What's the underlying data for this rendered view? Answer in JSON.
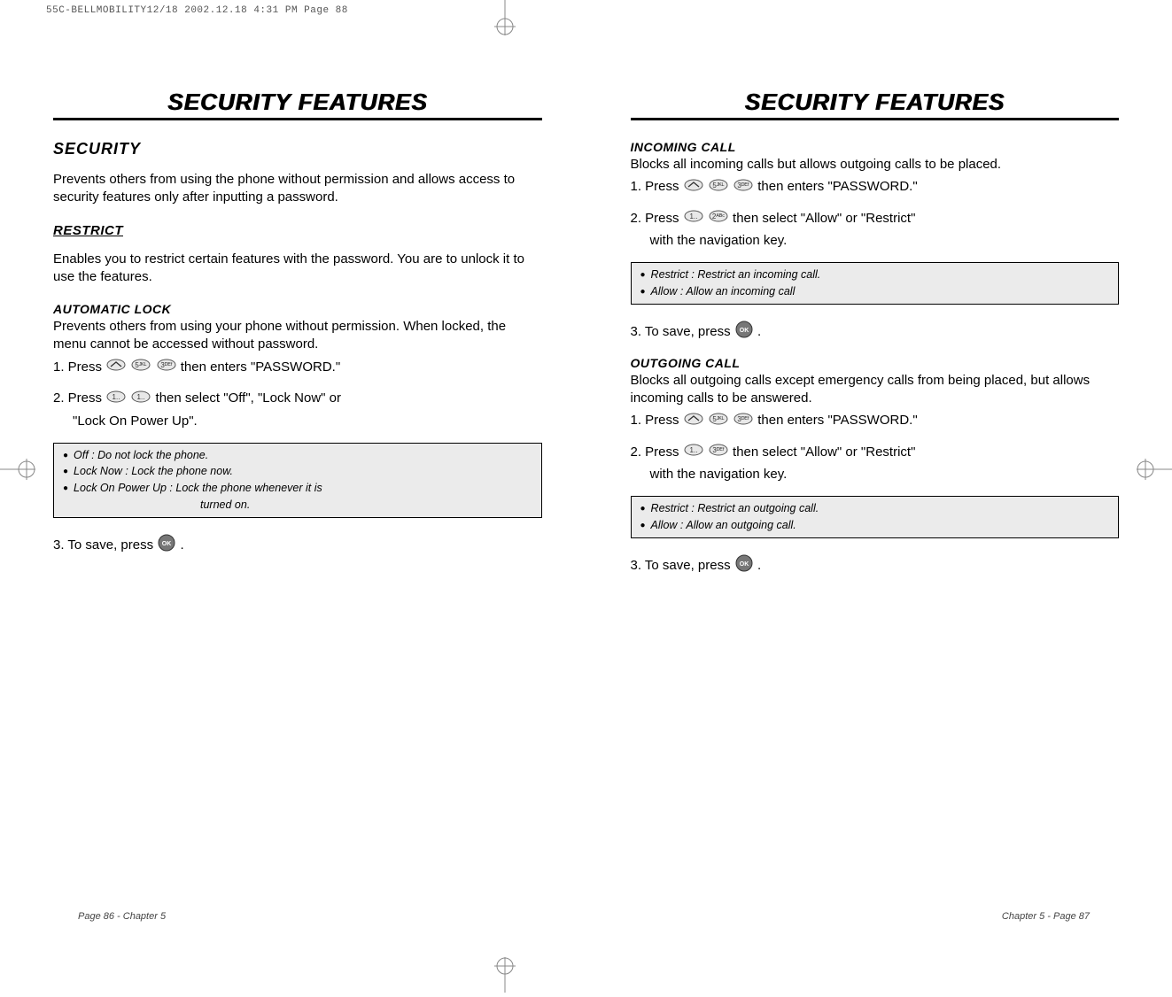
{
  "header": {
    "filename_info": "55C-BELLMOBILITY12/18  2002.12.18  4:31 PM  Page 88"
  },
  "left_page": {
    "title": "SECURITY FEATURES",
    "section": "SECURITY",
    "intro": "Prevents others from using the phone without permission and allows access to security features only after inputting a password.",
    "restrict": {
      "heading": "RESTRICT",
      "body": "Enables you to restrict certain features with the password. You are to unlock it to use the features."
    },
    "automatic_lock": {
      "heading": "AUTOMATIC LOCK",
      "body": "Prevents others from using your phone without permission. When locked, the menu cannot be accessed without password.",
      "step1_a": "1. Press",
      "step1_b": "then enters \"PASSWORD.\"",
      "step2_a": "2. Press",
      "step2_b": "then select \"Off\", \"Lock Now\" or",
      "step2_c": "\"Lock On Power Up\".",
      "notes": [
        "Off : Do not lock the phone.",
        "Lock Now : Lock the phone now.",
        "Lock On Power Up : Lock the phone whenever it is"
      ],
      "note_indent": "turned on.",
      "step3_a": "3. To save, press",
      "step3_b": "."
    },
    "footer": "Page 86 - Chapter 5"
  },
  "right_page": {
    "title": "SECURITY FEATURES",
    "incoming": {
      "heading": "INCOMING CALL",
      "body": "Blocks all incoming calls but allows outgoing calls to be placed.",
      "step1_a": "1. Press",
      "step1_b": "then enters \"PASSWORD.\"",
      "step2_a": "2. Press",
      "step2_b": "then select \"Allow\" or \"Restrict\"",
      "step2_c": "with the navigation key.",
      "notes": [
        "Restrict : Restrict an incoming call.",
        "Allow : Allow an incoming call"
      ],
      "step3_a": "3. To save, press",
      "step3_b": "."
    },
    "outgoing": {
      "heading": "OUTGOING CALL",
      "body": "Blocks all outgoing calls except emergency calls from being placed, but allows incoming calls to be answered.",
      "step1_a": "1. Press",
      "step1_b": "then enters \"PASSWORD.\"",
      "step2_a": "2. Press",
      "step2_b": "then select \"Allow\" or \"Restrict\"",
      "step2_c": "with the navigation key.",
      "notes": [
        "Restrict : Restrict an outgoing call.",
        "Allow : Allow an outgoing call."
      ],
      "step3_a": "3. To save, press",
      "step3_b": "."
    },
    "footer": "Chapter 5 - Page 87"
  }
}
